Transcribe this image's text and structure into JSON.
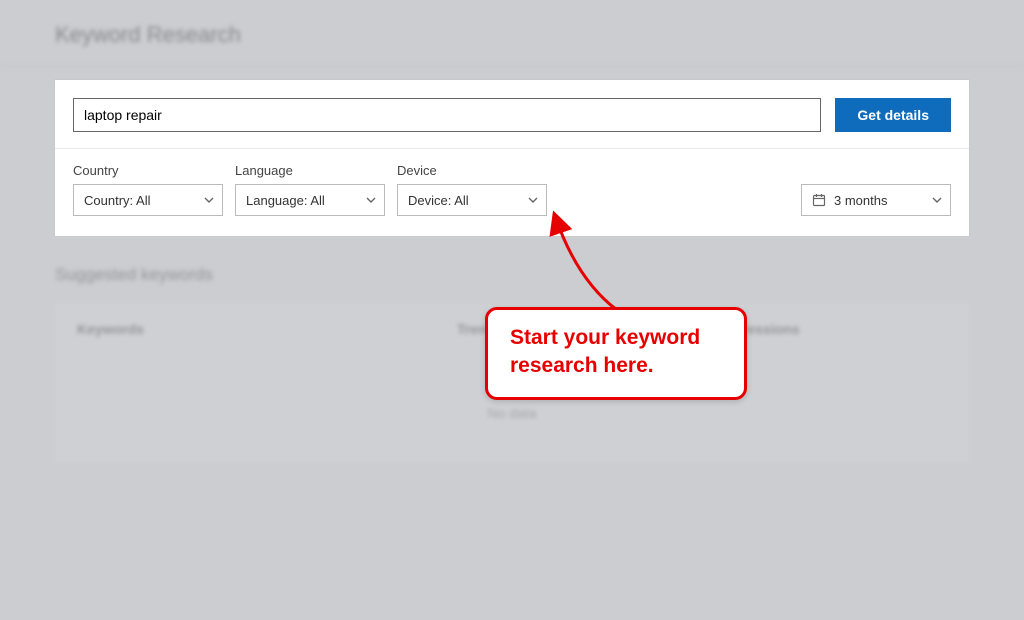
{
  "page_title": "Keyword Research",
  "search": {
    "value": "laptop repair",
    "button_label": "Get details"
  },
  "filters": {
    "country": {
      "label": "Country",
      "value": "Country: All"
    },
    "language": {
      "label": "Language",
      "value": "Language: All"
    },
    "device": {
      "label": "Device",
      "value": "Device: All"
    },
    "date_range": {
      "value": "3 months"
    }
  },
  "suggested": {
    "section_title": "Suggested keywords",
    "columns": {
      "keywords": "Keywords",
      "trend": "Trend",
      "impressions": "Impressions"
    },
    "empty_text": "No data"
  },
  "annotation": {
    "text": "Start your keyword research here."
  },
  "colors": {
    "primary": "#0f6cbd",
    "annotation_red": "#e60000"
  }
}
